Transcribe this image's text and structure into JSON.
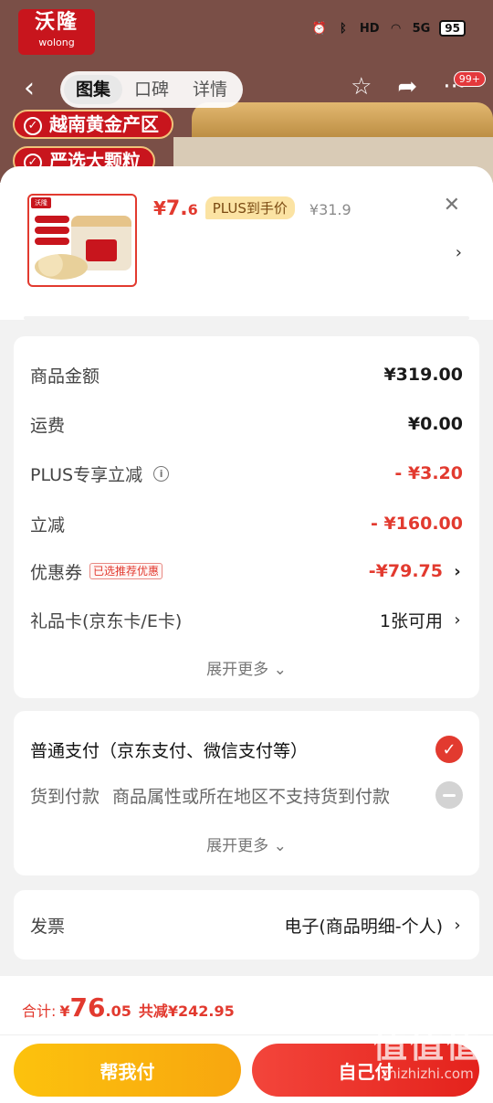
{
  "background": {
    "brand": {
      "cn": "沃隆",
      "en": "wolong"
    },
    "status": {
      "battery": "95",
      "network": "5G",
      "hd": "HD"
    },
    "tabs": [
      "图集",
      "口碑",
      "详情"
    ],
    "active_tab": "图集",
    "cart_badge": "99+",
    "tags": [
      "越南黄金产区",
      "严选大颗粒"
    ]
  },
  "product": {
    "price_currency": "¥",
    "price_int": "7.",
    "price_dec": "6",
    "plus_badge": "PLUS到手价",
    "original_price": "¥31.9"
  },
  "summary": {
    "rows": [
      {
        "label": "商品金额",
        "value": "¥319.00"
      },
      {
        "label": "运费",
        "value": "¥0.00"
      },
      {
        "label": "PLUS专享立减",
        "value": "- ¥3.20"
      },
      {
        "label": "立减",
        "value": "- ¥160.00"
      },
      {
        "label": "优惠券",
        "tag": "已选推荐优惠",
        "value": "-¥79.75"
      },
      {
        "label": "礼品卡(京东卡/E卡)",
        "value": "1张可用"
      }
    ],
    "expand_label": "展开更多 ⌄"
  },
  "payment": {
    "option1": "普通支付（京东支付、微信支付等）",
    "option2": "货到付款",
    "option2_note": "商品属性或所在地区不支持货到付款",
    "expand_label": "展开更多 ⌄"
  },
  "invoice": {
    "label": "发票",
    "value": "电子(商品明细-个人)"
  },
  "footer": {
    "total_label": "合计:",
    "total_currency": "¥",
    "total_int": "76",
    "total_dec": ".05",
    "total_saved": "共减¥242.95",
    "btn_help": "帮我付",
    "btn_self": "自己付"
  },
  "watermark": {
    "cn": "值值值",
    "en": "zhizhizhi.com"
  },
  "colors": {
    "accent_red": "#e23a2f",
    "help_yellow": "#fcc20d",
    "plus_gold": "#fbe3a3"
  }
}
